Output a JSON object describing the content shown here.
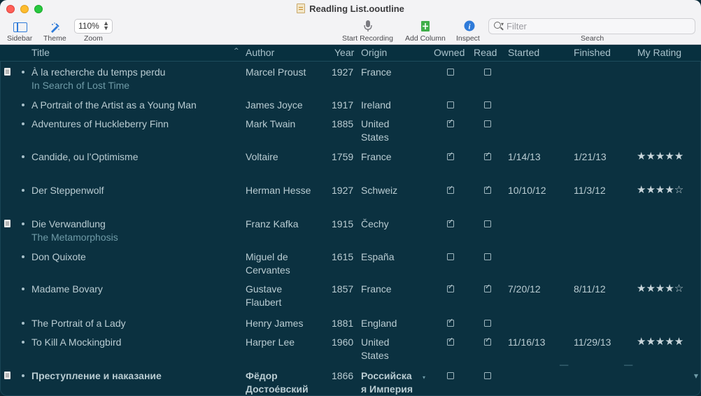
{
  "window": {
    "title": "Readling List.ooutline"
  },
  "toolbar": {
    "sidebar_label": "Sidebar",
    "theme_label": "Theme",
    "zoom_value": "110%",
    "zoom_label": "Zoom",
    "start_recording_label": "Start Recording",
    "add_column_label": "Add Column",
    "inspect_label": "Inspect",
    "filter_placeholder": "Filter",
    "search_label": "Search"
  },
  "columns": {
    "title": "Title",
    "author": "Author",
    "year": "Year",
    "origin": "Origin",
    "owned": "Owned",
    "read": "Read",
    "started": "Started",
    "finished": "Finished",
    "rating": "My Rating"
  },
  "rows": [
    {
      "title": "À la recherche du temps perdu",
      "subtitle": "In Search of Lost Time",
      "author": "Marcel Proust",
      "author2": "",
      "year": "1927",
      "origin": "France",
      "origin2": "",
      "owned": false,
      "read": false,
      "started": "",
      "finished": "",
      "rating": "",
      "note": true
    },
    {
      "title": "A Portrait of the Artist as a Young Man",
      "subtitle": "",
      "author": "James Joyce",
      "author2": "",
      "year": "1917",
      "origin": "Ireland",
      "origin2": "",
      "owned": false,
      "read": false,
      "started": "",
      "finished": "",
      "rating": "",
      "note": false
    },
    {
      "title": "Adventures of Huckleberry Finn",
      "subtitle": "",
      "author": "Mark Twain",
      "author2": "",
      "year": "1885",
      "origin": "United",
      "origin2": "States",
      "owned": true,
      "read": false,
      "started": "",
      "finished": "",
      "rating": "",
      "note": false
    },
    {
      "title": "Candide, ou l’Optimisme",
      "subtitle": "",
      "author": "Voltaire",
      "author2": "",
      "year": "1759",
      "origin": "France",
      "origin2": "",
      "owned": true,
      "read": true,
      "started": "1/14/13",
      "finished": "1/21/13",
      "rating": "★★★★★",
      "note": false
    },
    {
      "title": "Der Steppenwolf",
      "subtitle": "",
      "author": "Herman Hesse",
      "author2": "",
      "year": "1927",
      "origin": "Schweiz",
      "origin2": "",
      "owned": true,
      "read": true,
      "started": "10/10/12",
      "finished": "11/3/12",
      "rating": "★★★★☆",
      "note": false
    },
    {
      "title": "Die Verwandlung",
      "subtitle": "The Metamorphosis",
      "author": "Franz Kafka",
      "author2": "",
      "year": "1915",
      "origin": "Čechy",
      "origin2": "",
      "owned": true,
      "read": false,
      "started": "",
      "finished": "",
      "rating": "",
      "note": true
    },
    {
      "title": "Don Quixote",
      "subtitle": "",
      "author": "Miguel de",
      "author2": "Cervantes",
      "year": "1615",
      "origin": "España",
      "origin2": "",
      "owned": false,
      "read": false,
      "started": "",
      "finished": "",
      "rating": "",
      "note": false
    },
    {
      "title": "Madame Bovary",
      "subtitle": "",
      "author": "Gustave",
      "author2": "Flaubert",
      "year": "1857",
      "origin": "France",
      "origin2": "",
      "owned": true,
      "read": true,
      "started": "7/20/12",
      "finished": "8/11/12",
      "rating": "★★★★☆",
      "note": false
    },
    {
      "title": "The Portrait of a Lady",
      "subtitle": "",
      "author": "Henry James",
      "author2": "",
      "year": "1881",
      "origin": "England",
      "origin2": "",
      "owned": true,
      "read": false,
      "started": "",
      "finished": "",
      "rating": "",
      "note": false
    },
    {
      "title": "To Kill A Mockingbird",
      "subtitle": "",
      "author": "Harper Lee",
      "author2": "",
      "year": "1960",
      "origin": "United",
      "origin2": "States",
      "owned": true,
      "read": true,
      "started": "11/16/13",
      "finished": "11/29/13",
      "rating": "★★★★★",
      "note": false
    },
    {
      "title": "Преступление и наказание",
      "subtitle": "",
      "author": "Фёдор",
      "author2": "Достое́вский",
      "year": "1866",
      "origin": "Российска",
      "origin2": "я Империя",
      "owned": false,
      "read": false,
      "started": "",
      "finished": "",
      "rating": "",
      "note": true,
      "selected": true
    }
  ]
}
